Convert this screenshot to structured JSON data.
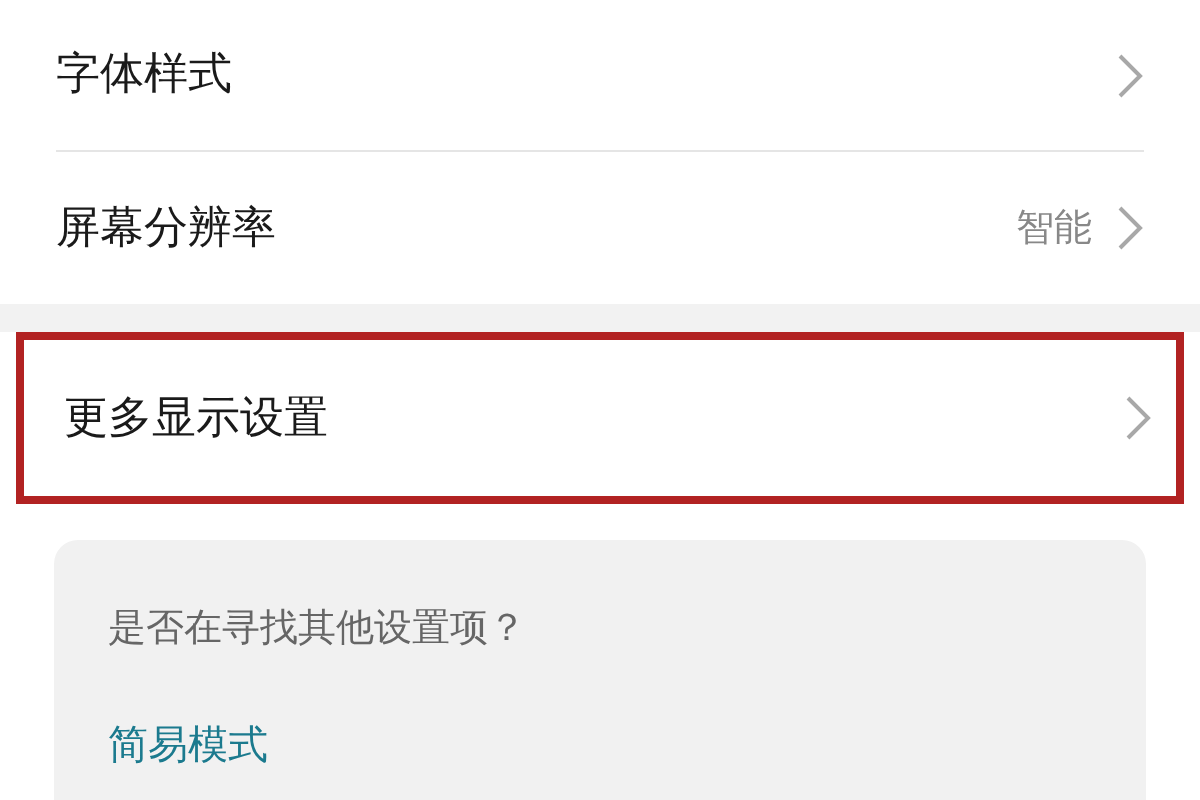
{
  "groups": [
    {
      "items": [
        {
          "label": "字体样式",
          "highlighted": false
        },
        {
          "label": "屏幕分辨率",
          "value": "智能",
          "highlighted": false
        }
      ]
    },
    {
      "items": [
        {
          "label": "更多显示设置",
          "highlighted": true
        }
      ]
    }
  ],
  "suggestion": {
    "question": "是否在寻找其他设置项？",
    "link": "简易模式"
  }
}
